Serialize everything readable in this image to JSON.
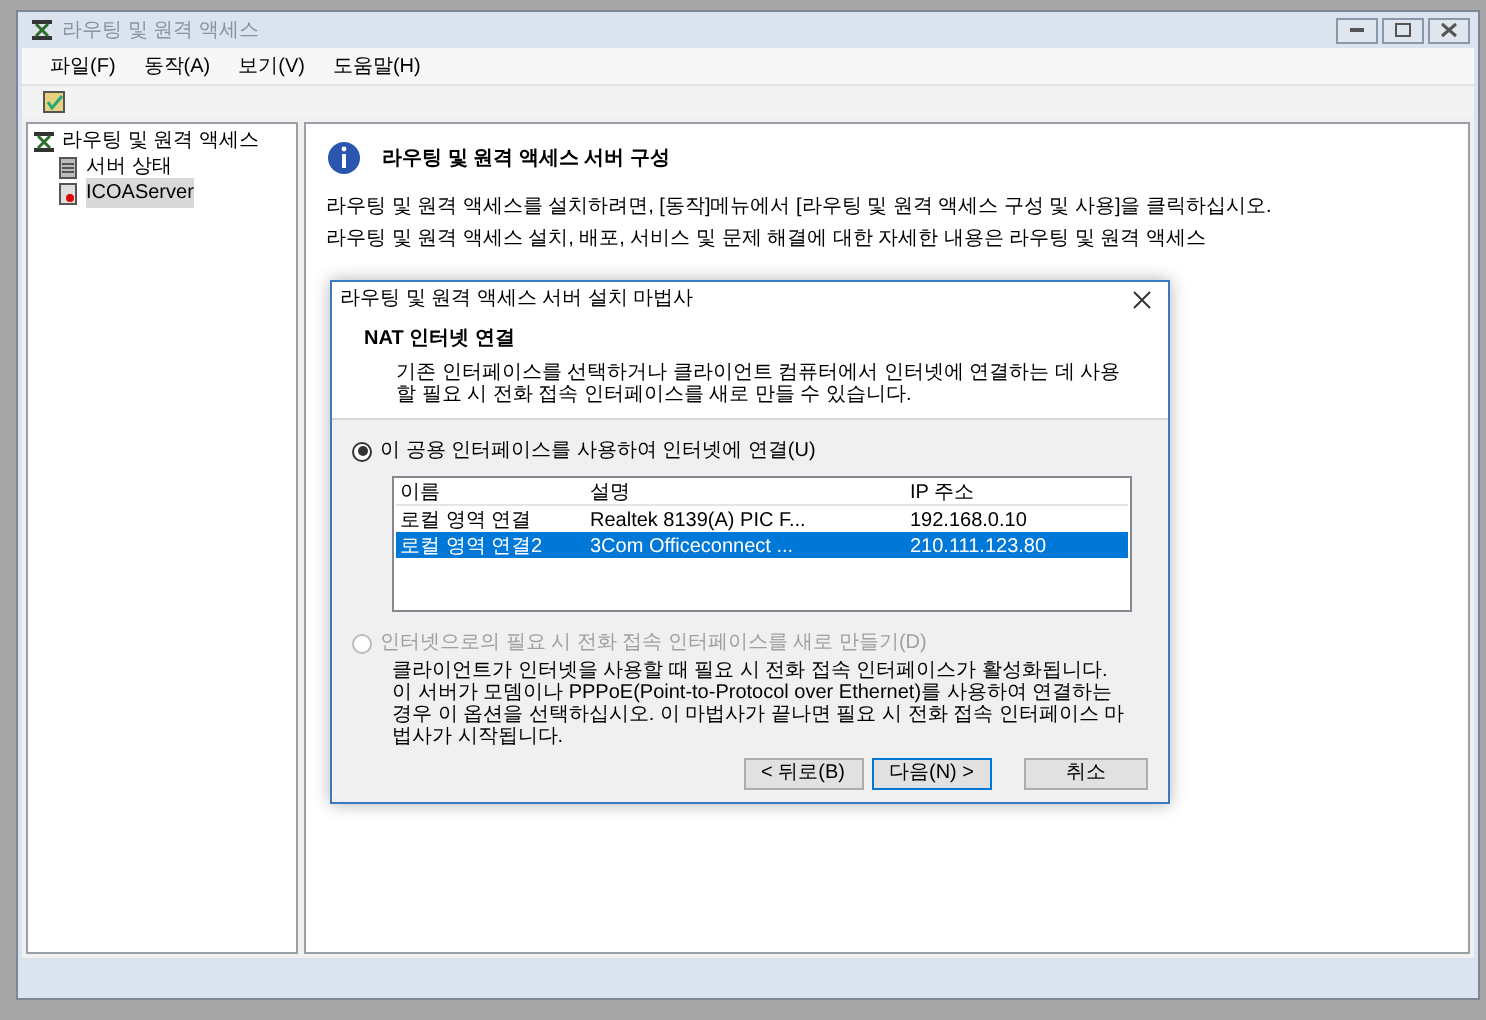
{
  "window": {
    "title": "라우팅 및 원격 액세스"
  },
  "menu": [
    {
      "label": "파일(F)"
    },
    {
      "label": "동작(A)"
    },
    {
      "label": "보기(V)"
    },
    {
      "label": "도움말(H)"
    }
  ],
  "tree": [
    {
      "label": "라우팅 및 원격 액세스",
      "selected": false,
      "kind": "root",
      "children": [
        {
          "label": "서버 상태",
          "selected": false,
          "kind": "status"
        },
        {
          "label": "ICOAServer",
          "selected": true,
          "kind": "server"
        }
      ]
    }
  ],
  "main": {
    "heading": "라우팅 및 원격 액세스 서버 구성",
    "paragraphs": [
      "라우팅 및 원격 액세스를 설치하려면, [동작]메뉴에서 [라우팅 및 원격 액세스 구성 및 사용]을 클릭하십시오.",
      "라우팅 및 원격 액세스 설치, 배포, 서비스 및 문제 해결에 대한 자세한 내용은 라우팅 및 원격 액세스"
    ]
  },
  "dialog": {
    "title": "라우팅 및 원격 액세스 서버 설치 마법사",
    "heading": "NAT 인터넷 연결",
    "description": "기존 인터페이스를 선택하거나 클라이언트 컴퓨터에서 인터넷에 연결하는 데 사용할 필요 시 전화 접속 인터페이스를 새로 만들 수 있습니다.",
    "options": [
      {
        "label": "이 공용 인터페이스를 사용하여 인터넷에 연결(U)",
        "selected": true,
        "disabled": false,
        "table": {
          "columns": [
            "이름",
            "설명",
            "IP 주소"
          ],
          "rows": [
            {
              "cells": [
                "로컬 영역 연결",
                "Realtek 8139(A) PIC F...",
                "192.168.0.10"
              ],
              "selected": false
            },
            {
              "cells": [
                "로컬 영역 연결2",
                "3Com Officeconnect ...",
                "210.111.123.80"
              ],
              "selected": true
            }
          ]
        }
      },
      {
        "label": "인터넷으로의 필요 시 전화 접속 인터페이스를 새로 만들기(D)",
        "selected": false,
        "disabled": true,
        "description": "클라이언트가 인터넷을 사용할 때 필요 시 전화 접속 인터페이스가 활성화됩니다. 이 서버가 모뎀이나 PPPoE(Point-to-Protocol over Ethernet)를 사용하여 연결하는 경우 이 옵션을 선택하십시오. 이 마법사가 끝나면 필요 시 전화 접속 인터페이스 마법사가 시작됩니다."
      }
    ],
    "buttons": [
      {
        "label": "< 뒤로(B)",
        "kind": "back"
      },
      {
        "label": "다음(N) >",
        "kind": "next"
      },
      {
        "label": "취소",
        "kind": "cancel"
      }
    ]
  }
}
